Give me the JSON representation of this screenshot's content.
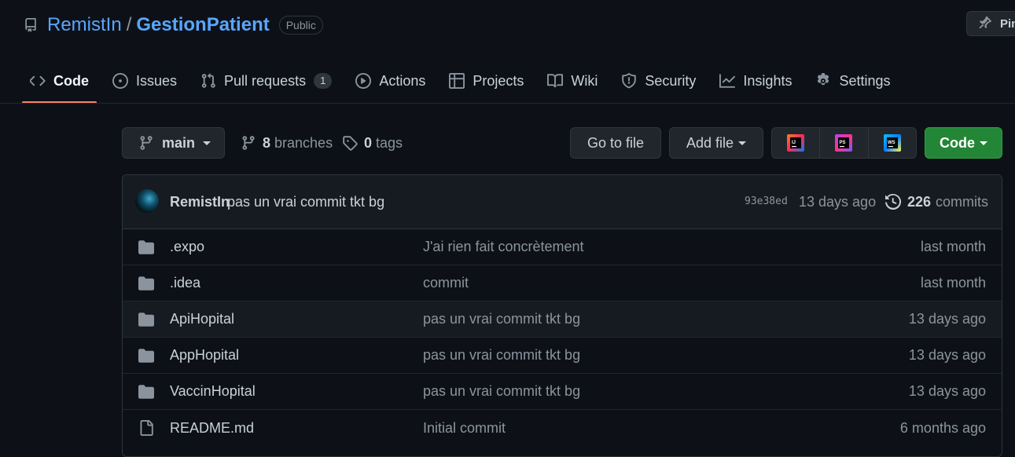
{
  "repo": {
    "owner": "RemistIn",
    "separator": "/",
    "name": "GestionPatient",
    "visibility": "Public"
  },
  "header_actions": {
    "pin_label": "Pin"
  },
  "tabs": [
    {
      "label": "Code",
      "icon": "code-icon",
      "active": true
    },
    {
      "label": "Issues",
      "icon": "issue-icon"
    },
    {
      "label": "Pull requests",
      "icon": "pull-request-icon",
      "count": "1"
    },
    {
      "label": "Actions",
      "icon": "play-icon"
    },
    {
      "label": "Projects",
      "icon": "table-icon"
    },
    {
      "label": "Wiki",
      "icon": "book-icon"
    },
    {
      "label": "Security",
      "icon": "shield-icon"
    },
    {
      "label": "Insights",
      "icon": "graph-icon"
    },
    {
      "label": "Settings",
      "icon": "gear-icon"
    }
  ],
  "toolbar": {
    "branch": "main",
    "branches_count": "8",
    "branches_label": "branches",
    "tags_count": "0",
    "tags_label": "tags",
    "go_to_file": "Go to file",
    "add_file": "Add file",
    "ide_buttons": [
      "IJ",
      "PS",
      "WS"
    ],
    "code_label": "Code"
  },
  "last_commit": {
    "author": "RemistIn",
    "message": "pas un vrai commit tkt bg",
    "sha": "93e38ed",
    "time": "13 days ago",
    "commits_count": "226",
    "commits_label": "commits"
  },
  "files": [
    {
      "type": "dir",
      "name": ".expo",
      "message": "J'ai rien fait concrètement",
      "age": "last month"
    },
    {
      "type": "dir",
      "name": ".idea",
      "message": "commit",
      "age": "last month"
    },
    {
      "type": "dir",
      "name": "ApiHopital",
      "message": "pas un vrai commit tkt bg",
      "age": "13 days ago"
    },
    {
      "type": "dir",
      "name": "AppHopital",
      "message": "pas un vrai commit tkt bg",
      "age": "13 days ago"
    },
    {
      "type": "dir",
      "name": "VaccinHopital",
      "message": "pas un vrai commit tkt bg",
      "age": "13 days ago"
    },
    {
      "type": "file",
      "name": "README.md",
      "message": "Initial commit",
      "age": "6 months ago"
    }
  ],
  "colors": {
    "background": "#0d1117",
    "link": "#58a6ff",
    "accent_tab": "#f78166",
    "code_button": "#238636",
    "muted": "#8b949e"
  }
}
